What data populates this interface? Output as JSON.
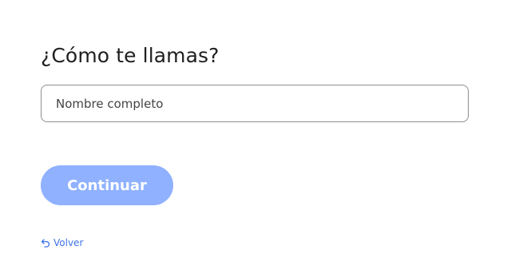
{
  "form": {
    "title": "¿Cómo te llamas?",
    "name_input": {
      "placeholder": "Nombre completo",
      "value": ""
    },
    "continue_label": "Continuar",
    "back_label": "Volver",
    "back_icon": "undo-arrow-icon"
  },
  "colors": {
    "button_bg": "#8fb1ff",
    "button_text": "#ffffff",
    "link": "#3f73e8",
    "title_text": "#1f1f1f",
    "field_border": "#8f8f8f"
  }
}
